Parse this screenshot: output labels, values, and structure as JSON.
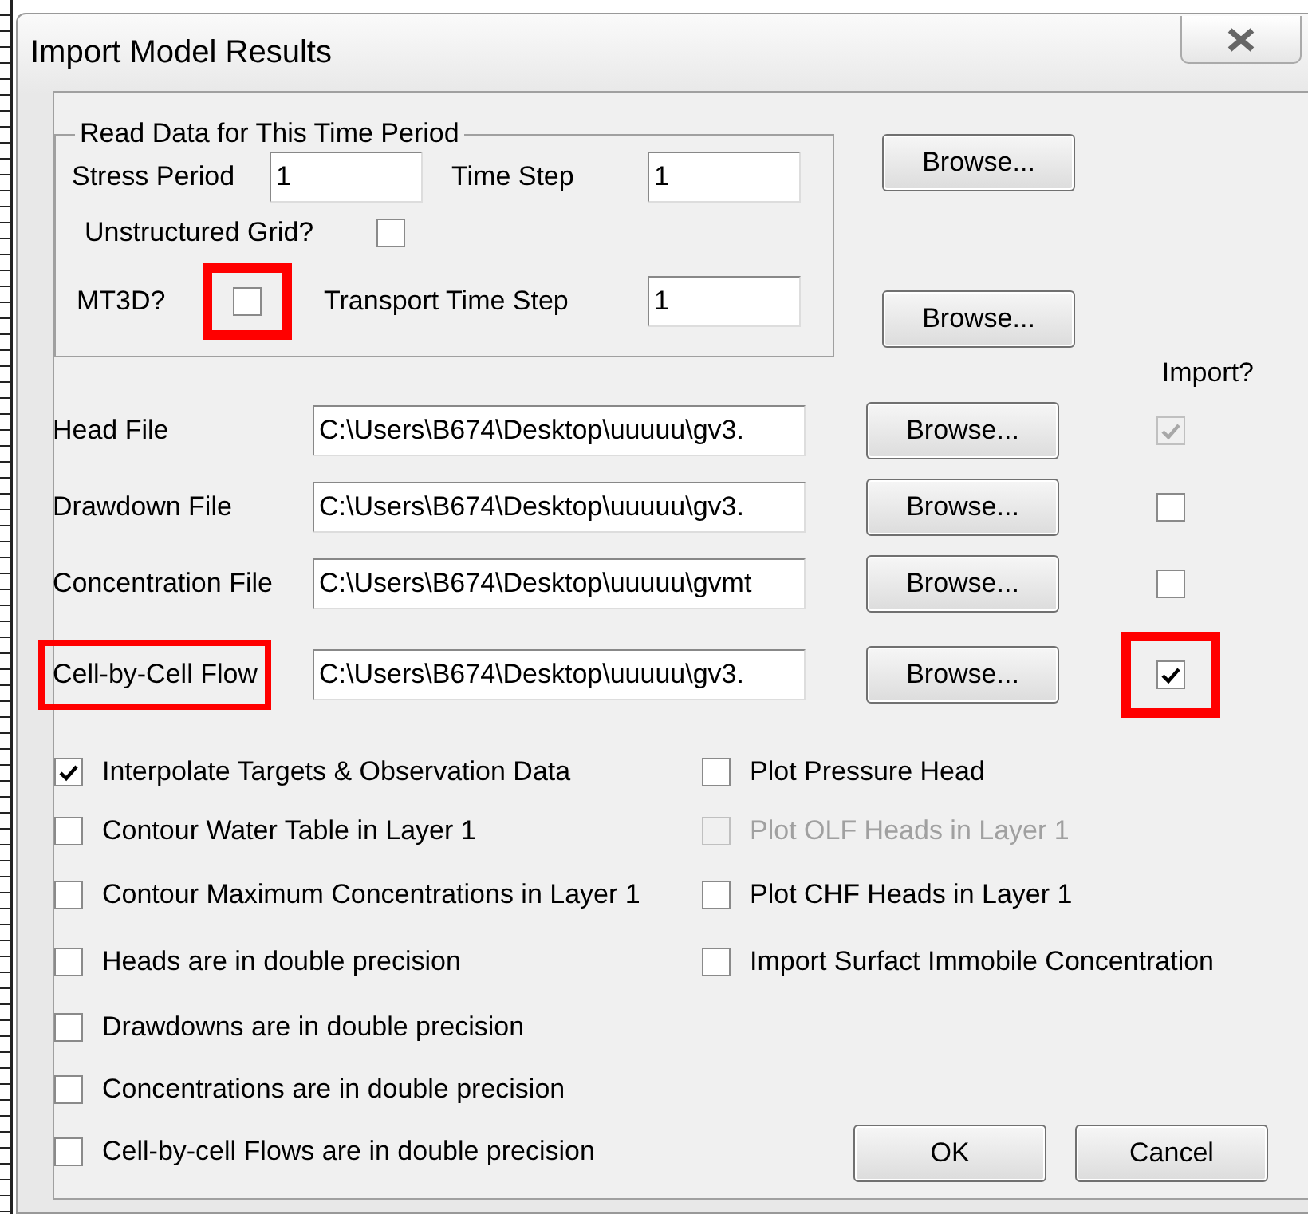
{
  "window": {
    "title": "Import Model Results"
  },
  "time_period": {
    "title": "Read Data for This Time Period",
    "stress_period": {
      "label": "Stress Period",
      "value": "1"
    },
    "time_step": {
      "label": "Time Step",
      "value": "1"
    },
    "unstructured_grid": {
      "label": "Unstructured Grid?",
      "checked": false
    },
    "mt3d": {
      "label": "MT3D?",
      "checked": false,
      "highlighted": true
    },
    "transport_time_step": {
      "label": "Transport Time Step",
      "value": "1"
    },
    "browse_buttons": [
      "Browse...",
      "Browse..."
    ]
  },
  "import_header": "Import?",
  "files": [
    {
      "label": "Head File",
      "path": "C:\\Users\\B674\\Desktop\\uuuuu\\gv3.",
      "browse": "Browse...",
      "import_checked": true,
      "import_disabled": true,
      "label_highlighted": false,
      "import_highlighted": false
    },
    {
      "label": "Drawdown File",
      "path": "C:\\Users\\B674\\Desktop\\uuuuu\\gv3.",
      "browse": "Browse...",
      "import_checked": false,
      "import_disabled": false,
      "label_highlighted": false,
      "import_highlighted": false
    },
    {
      "label": "Concentration File",
      "path": "C:\\Users\\B674\\Desktop\\uuuuu\\gvmt",
      "browse": "Browse...",
      "import_checked": false,
      "import_disabled": false,
      "label_highlighted": false,
      "import_highlighted": false
    },
    {
      "label": "Cell-by-Cell Flow",
      "path": "C:\\Users\\B674\\Desktop\\uuuuu\\gv3.",
      "browse": "Browse...",
      "import_checked": true,
      "import_disabled": false,
      "label_highlighted": true,
      "import_highlighted": true
    }
  ],
  "options_left": [
    {
      "label": "Interpolate Targets & Observation Data",
      "checked": true,
      "disabled": false
    },
    {
      "label": "Contour Water Table in Layer 1",
      "checked": false,
      "disabled": false
    },
    {
      "label": "Contour Maximum Concentrations in Layer 1",
      "checked": false,
      "disabled": false
    },
    {
      "label": "Heads are in double precision",
      "checked": false,
      "disabled": false
    },
    {
      "label": "Drawdowns are in double precision",
      "checked": false,
      "disabled": false
    },
    {
      "label": "Concentrations are in double precision",
      "checked": false,
      "disabled": false
    },
    {
      "label": "Cell-by-cell Flows are in double precision",
      "checked": false,
      "disabled": false
    }
  ],
  "options_right": [
    {
      "label": "Plot Pressure Head",
      "checked": false,
      "disabled": false
    },
    {
      "label": "Plot OLF Heads in Layer 1",
      "checked": false,
      "disabled": true
    },
    {
      "label": "Plot CHF Heads in Layer 1",
      "checked": false,
      "disabled": false
    },
    {
      "label": "Import Surfact Immobile Concentration",
      "checked": false,
      "disabled": false
    }
  ],
  "buttons": [
    "OK",
    "Cancel"
  ]
}
